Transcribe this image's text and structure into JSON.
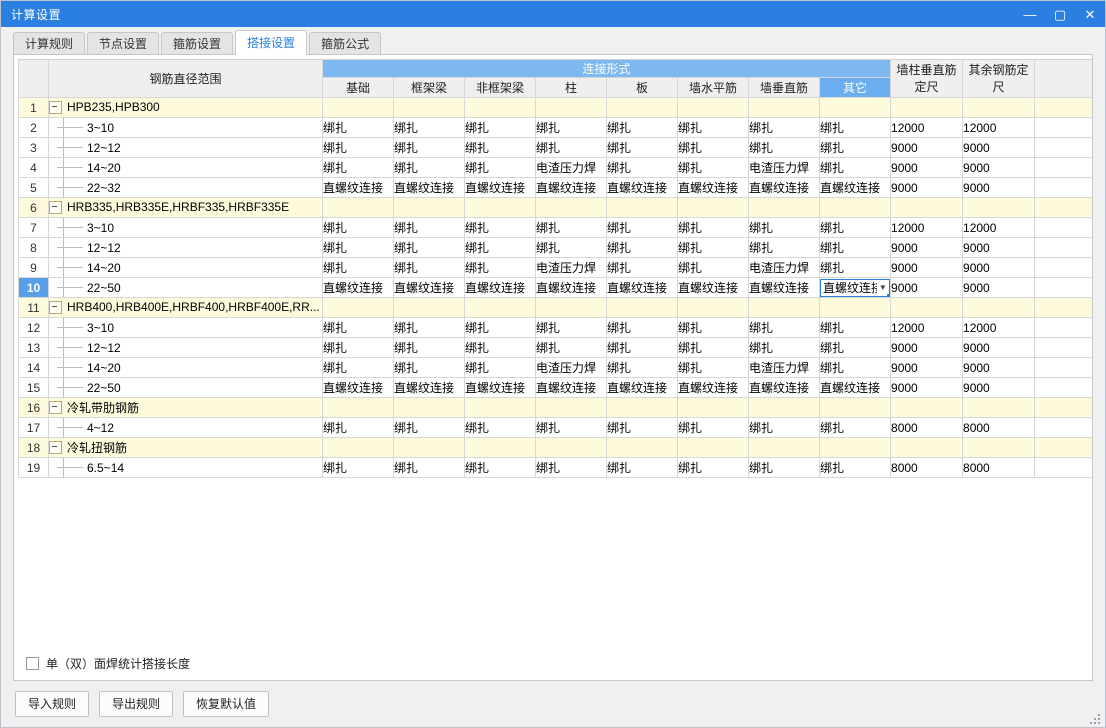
{
  "window": {
    "title": "计算设置",
    "controls": [
      {
        "name": "minimize-button",
        "glyph": "—"
      },
      {
        "name": "maximize-button",
        "glyph": "▢"
      },
      {
        "name": "close-button",
        "glyph": "✕"
      }
    ]
  },
  "tabs": [
    {
      "label": "计算规则",
      "active": false
    },
    {
      "label": "节点设置",
      "active": false
    },
    {
      "label": "箍筋设置",
      "active": false
    },
    {
      "label": "搭接设置",
      "active": true
    },
    {
      "label": "箍筋公式",
      "active": false
    }
  ],
  "table": {
    "group_header": "连接形式",
    "name_header": "钢筋直径范围",
    "connection_columns": [
      "基础",
      "框架梁",
      "非框架梁",
      "柱",
      "板",
      "墙水平筋",
      "墙垂直筋",
      "其它"
    ],
    "selected_column": "其它",
    "tail_columns": [
      "墙柱垂直筋定尺",
      "其余钢筋定尺"
    ],
    "rows": [
      {
        "num": "1",
        "type": "group",
        "label": "HPB235,HPB300",
        "values": [
          "",
          "",
          "",
          "",
          "",
          "",
          "",
          ""
        ],
        "tail": [
          "",
          ""
        ]
      },
      {
        "num": "2",
        "type": "leaf",
        "label": "3~10",
        "values": [
          "绑扎",
          "绑扎",
          "绑扎",
          "绑扎",
          "绑扎",
          "绑扎",
          "绑扎",
          "绑扎"
        ],
        "tail": [
          "12000",
          "12000"
        ]
      },
      {
        "num": "3",
        "type": "leaf",
        "label": "12~12",
        "values": [
          "绑扎",
          "绑扎",
          "绑扎",
          "绑扎",
          "绑扎",
          "绑扎",
          "绑扎",
          "绑扎"
        ],
        "tail": [
          "9000",
          "9000"
        ]
      },
      {
        "num": "4",
        "type": "leaf",
        "label": "14~20",
        "values": [
          "绑扎",
          "绑扎",
          "绑扎",
          "电渣压力焊",
          "绑扎",
          "绑扎",
          "电渣压力焊",
          "绑扎"
        ],
        "tail": [
          "9000",
          "9000"
        ]
      },
      {
        "num": "5",
        "type": "leaf",
        "label": "22~32",
        "values": [
          "直螺纹连接",
          "直螺纹连接",
          "直螺纹连接",
          "直螺纹连接",
          "直螺纹连接",
          "直螺纹连接",
          "直螺纹连接",
          "直螺纹连接"
        ],
        "tail": [
          "9000",
          "9000"
        ]
      },
      {
        "num": "6",
        "type": "group",
        "label": "HRB335,HRB335E,HRBF335,HRBF335E",
        "values": [
          "",
          "",
          "",
          "",
          "",
          "",
          "",
          ""
        ],
        "tail": [
          "",
          ""
        ]
      },
      {
        "num": "7",
        "type": "leaf",
        "label": "3~10",
        "values": [
          "绑扎",
          "绑扎",
          "绑扎",
          "绑扎",
          "绑扎",
          "绑扎",
          "绑扎",
          "绑扎"
        ],
        "tail": [
          "12000",
          "12000"
        ]
      },
      {
        "num": "8",
        "type": "leaf",
        "label": "12~12",
        "values": [
          "绑扎",
          "绑扎",
          "绑扎",
          "绑扎",
          "绑扎",
          "绑扎",
          "绑扎",
          "绑扎"
        ],
        "tail": [
          "9000",
          "9000"
        ]
      },
      {
        "num": "9",
        "type": "leaf",
        "label": "14~20",
        "values": [
          "绑扎",
          "绑扎",
          "绑扎",
          "电渣压力焊",
          "绑扎",
          "绑扎",
          "电渣压力焊",
          "绑扎"
        ],
        "tail": [
          "9000",
          "9000"
        ]
      },
      {
        "num": "10",
        "type": "leaf",
        "selected": true,
        "editing_col": 7,
        "label": "22~50",
        "values": [
          "直螺纹连接",
          "直螺纹连接",
          "直螺纹连接",
          "直螺纹连接",
          "直螺纹连接",
          "直螺纹连接",
          "直螺纹连接",
          "直螺纹连接"
        ],
        "tail": [
          "9000",
          "9000"
        ]
      },
      {
        "num": "11",
        "type": "group",
        "label": "HRB400,HRB400E,HRBF400,HRBF400E,RR...",
        "values": [
          "",
          "",
          "",
          "",
          "",
          "",
          "",
          ""
        ],
        "tail": [
          "",
          ""
        ]
      },
      {
        "num": "12",
        "type": "leaf",
        "label": "3~10",
        "values": [
          "绑扎",
          "绑扎",
          "绑扎",
          "绑扎",
          "绑扎",
          "绑扎",
          "绑扎",
          "绑扎"
        ],
        "tail": [
          "12000",
          "12000"
        ]
      },
      {
        "num": "13",
        "type": "leaf",
        "label": "12~12",
        "values": [
          "绑扎",
          "绑扎",
          "绑扎",
          "绑扎",
          "绑扎",
          "绑扎",
          "绑扎",
          "绑扎"
        ],
        "tail": [
          "9000",
          "9000"
        ]
      },
      {
        "num": "14",
        "type": "leaf",
        "label": "14~20",
        "values": [
          "绑扎",
          "绑扎",
          "绑扎",
          "电渣压力焊",
          "绑扎",
          "绑扎",
          "电渣压力焊",
          "绑扎"
        ],
        "tail": [
          "9000",
          "9000"
        ]
      },
      {
        "num": "15",
        "type": "leaf",
        "label": "22~50",
        "values": [
          "直螺纹连接",
          "直螺纹连接",
          "直螺纹连接",
          "直螺纹连接",
          "直螺纹连接",
          "直螺纹连接",
          "直螺纹连接",
          "直螺纹连接"
        ],
        "tail": [
          "9000",
          "9000"
        ]
      },
      {
        "num": "16",
        "type": "group",
        "label": "冷轧带肋钢筋",
        "values": [
          "",
          "",
          "",
          "",
          "",
          "",
          "",
          ""
        ],
        "tail": [
          "",
          ""
        ]
      },
      {
        "num": "17",
        "type": "leaf",
        "label": "4~12",
        "values": [
          "绑扎",
          "绑扎",
          "绑扎",
          "绑扎",
          "绑扎",
          "绑扎",
          "绑扎",
          "绑扎"
        ],
        "tail": [
          "8000",
          "8000"
        ]
      },
      {
        "num": "18",
        "type": "group",
        "label": "冷轧扭钢筋",
        "values": [
          "",
          "",
          "",
          "",
          "",
          "",
          "",
          ""
        ],
        "tail": [
          "",
          ""
        ]
      },
      {
        "num": "19",
        "type": "leaf",
        "label": "6.5~14",
        "values": [
          "绑扎",
          "绑扎",
          "绑扎",
          "绑扎",
          "绑扎",
          "绑扎",
          "绑扎",
          "绑扎"
        ],
        "tail": [
          "8000",
          "8000"
        ]
      }
    ],
    "editing_cell": {
      "text": "直螺纹连接",
      "arrow": "▼"
    }
  },
  "footer": {
    "checkbox_label": "单（双）面焊统计搭接长度",
    "checkbox_checked": false,
    "buttons": [
      {
        "name": "import-rules-button",
        "label": "导入规则"
      },
      {
        "name": "export-rules-button",
        "label": "导出规则"
      },
      {
        "name": "restore-defaults-button",
        "label": "恢复默认值"
      }
    ]
  },
  "colors": {
    "titlebar": "#2a7fe0",
    "group_header": "#7db9f0",
    "selected_col": "#6aaef0",
    "group_row": "#fdfbdc",
    "selected_rownum": "#579fe6",
    "accent": "#2a7fe0"
  }
}
